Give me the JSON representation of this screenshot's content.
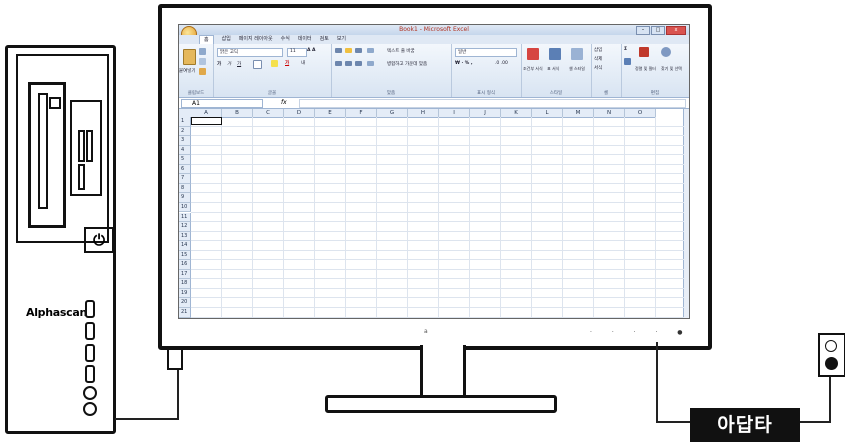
{
  "tower": {
    "brand": "Alphascan",
    "power_icon": "power-icon"
  },
  "monitor": {
    "bezel_logo": "a"
  },
  "excel": {
    "title": "Book1 - Microsoft Excel",
    "window_buttons": [
      "–",
      "□",
      "x"
    ],
    "tabs": [
      "홈",
      "삽입",
      "페이지 레이아웃",
      "수식",
      "데이터",
      "검토",
      "보기"
    ],
    "active_tab": "홈",
    "ribbon": {
      "clipboard": {
        "paste": "붙여넣기",
        "label": "클립보드"
      },
      "font": {
        "name": "맑은 고딕",
        "size": "11",
        "label": "글꼴"
      },
      "alignment": {
        "wrap": "텍스트 줄 바꿈",
        "merge": "병합하고 가운데 맞춤",
        "label": "맞춤"
      },
      "number": {
        "format": "일반",
        "label": "표시 형식"
      },
      "styles": {
        "conditional": "조건부 서식",
        "table": "표 서식",
        "cell": "셀 스타일",
        "label": "스타일"
      },
      "cells": {
        "insert": "삽입",
        "delete": "삭제",
        "format": "서식",
        "label": "셀"
      },
      "editing": {
        "sort": "정렬 및 필터",
        "find": "찾기 및 선택",
        "label": "편집"
      }
    },
    "name_box": "A1",
    "fx": "fx",
    "columns": [
      "A",
      "B",
      "C",
      "D",
      "E",
      "F",
      "G",
      "H",
      "I",
      "J",
      "K",
      "L",
      "M",
      "N",
      "O"
    ],
    "rows": [
      "1",
      "2",
      "3",
      "4",
      "5",
      "6",
      "7",
      "8",
      "9",
      "10",
      "11",
      "12",
      "13",
      "14",
      "15",
      "16",
      "17",
      "18",
      "19",
      "20",
      "21"
    ]
  },
  "adapter": {
    "label": "아답타"
  }
}
